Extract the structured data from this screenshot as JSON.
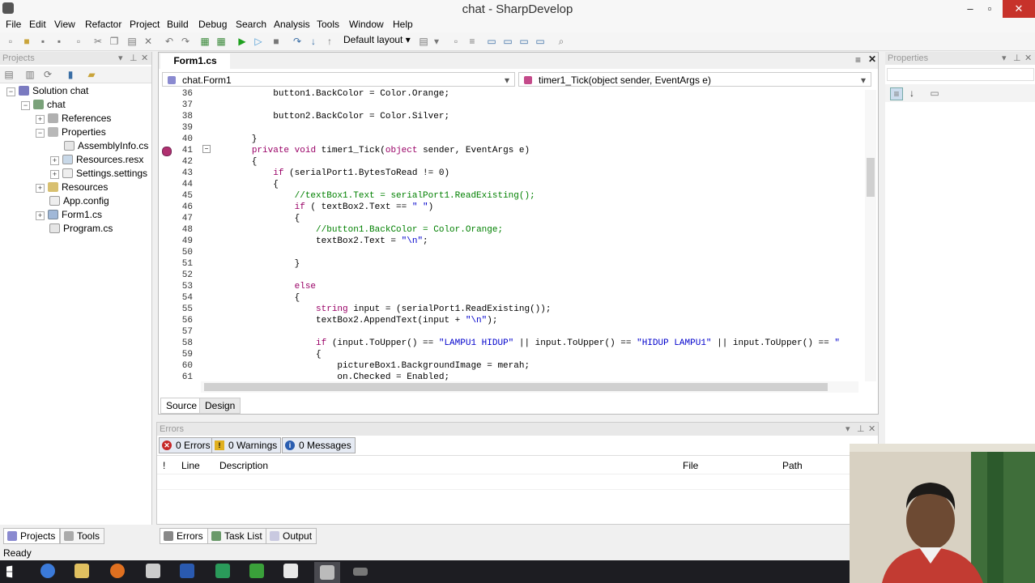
{
  "window": {
    "title": "chat - SharpDevelop",
    "minimize": "–",
    "maximize": "▫",
    "close": "✕"
  },
  "menu": [
    "File",
    "Edit",
    "View",
    "Refactor",
    "Project",
    "Build",
    "Debug",
    "Search",
    "Analysis",
    "Tools",
    "Window",
    "Help"
  ],
  "toolbar": {
    "layout_label": "Default layout"
  },
  "projects_panel": {
    "title": "Projects",
    "tree": [
      {
        "label": "Solution chat",
        "icon": "solution-icon"
      },
      {
        "label": "chat",
        "icon": "project-icon"
      },
      {
        "label": "References",
        "icon": "references-icon"
      },
      {
        "label": "Properties",
        "icon": "folder-icon"
      },
      {
        "label": "AssemblyInfo.cs",
        "icon": "cs-file-icon"
      },
      {
        "label": "Resources.resx",
        "icon": "resx-file-icon"
      },
      {
        "label": "Settings.settings",
        "icon": "settings-file-icon"
      },
      {
        "label": "Resources",
        "icon": "folder-icon"
      },
      {
        "label": "App.config",
        "icon": "config-file-icon"
      },
      {
        "label": "Form1.cs",
        "icon": "form-file-icon"
      },
      {
        "label": "Program.cs",
        "icon": "cs-file-icon"
      }
    ]
  },
  "editor": {
    "tab": "Form1.cs",
    "class_combo": "chat.Form1",
    "member_combo": "timer1_Tick(object sender, EventArgs e)",
    "bottom_tabs": [
      "Source",
      "Design"
    ],
    "lines": [
      {
        "n": "36",
        "t": "            button1.BackColor = Color.Orange;"
      },
      {
        "n": "37",
        "t": ""
      },
      {
        "n": "38",
        "t": "            button2.BackColor = Color.Silver;"
      },
      {
        "n": "39",
        "t": ""
      },
      {
        "n": "40",
        "t": "        }"
      },
      {
        "n": "41",
        "t": "        private void timer1_Tick(object sender, EventArgs e)"
      },
      {
        "n": "42",
        "t": "        {"
      },
      {
        "n": "43",
        "t": "            if (serialPort1.BytesToRead != 0)"
      },
      {
        "n": "44",
        "t": "            {"
      },
      {
        "n": "45",
        "t": "                //textBox1.Text = serialPort1.ReadExisting();"
      },
      {
        "n": "46",
        "t": "                if ( textBox2.Text == \" \")"
      },
      {
        "n": "47",
        "t": "                {"
      },
      {
        "n": "48",
        "t": "                    //button1.BackColor = Color.Orange;"
      },
      {
        "n": "49",
        "t": "                    textBox2.Text = \"\\n\";"
      },
      {
        "n": "50",
        "t": ""
      },
      {
        "n": "51",
        "t": "                }"
      },
      {
        "n": "52",
        "t": ""
      },
      {
        "n": "53",
        "t": "                else"
      },
      {
        "n": "54",
        "t": "                {"
      },
      {
        "n": "55",
        "t": "                    string input = (serialPort1.ReadExisting());"
      },
      {
        "n": "56",
        "t": "                    textBox2.AppendText(input + \"\\n\");"
      },
      {
        "n": "57",
        "t": ""
      },
      {
        "n": "58",
        "t": "                    if (input.ToUpper() == \"LAMPU1 HIDUP\" || input.ToUpper() == \"HIDUP LAMPU1\" || input.ToUpper() == \""
      },
      {
        "n": "59",
        "t": "                    {"
      },
      {
        "n": "60",
        "t": "                        pictureBox1.BackgroundImage = merah;"
      },
      {
        "n": "61",
        "t": "                        on.Checked = Enabled;"
      }
    ]
  },
  "properties_panel": {
    "title": "Properties"
  },
  "errors_panel": {
    "title": "Errors",
    "filters": [
      {
        "label": "0 Errors",
        "icon": "error-icon"
      },
      {
        "label": "0 Warnings",
        "icon": "warning-icon"
      },
      {
        "label": "0 Messages",
        "icon": "info-icon"
      }
    ],
    "columns": [
      "!",
      "Line",
      "Description",
      "File",
      "Path"
    ]
  },
  "bottom_tabs_left": [
    "Projects",
    "Tools"
  ],
  "bottom_tabs_center": [
    "Errors",
    "Task List",
    "Output"
  ],
  "status": "Ready",
  "colors": {
    "keyword": "#990066",
    "comment": "#008000",
    "string": "#0000cc",
    "taskbar": "#1d1d22"
  }
}
